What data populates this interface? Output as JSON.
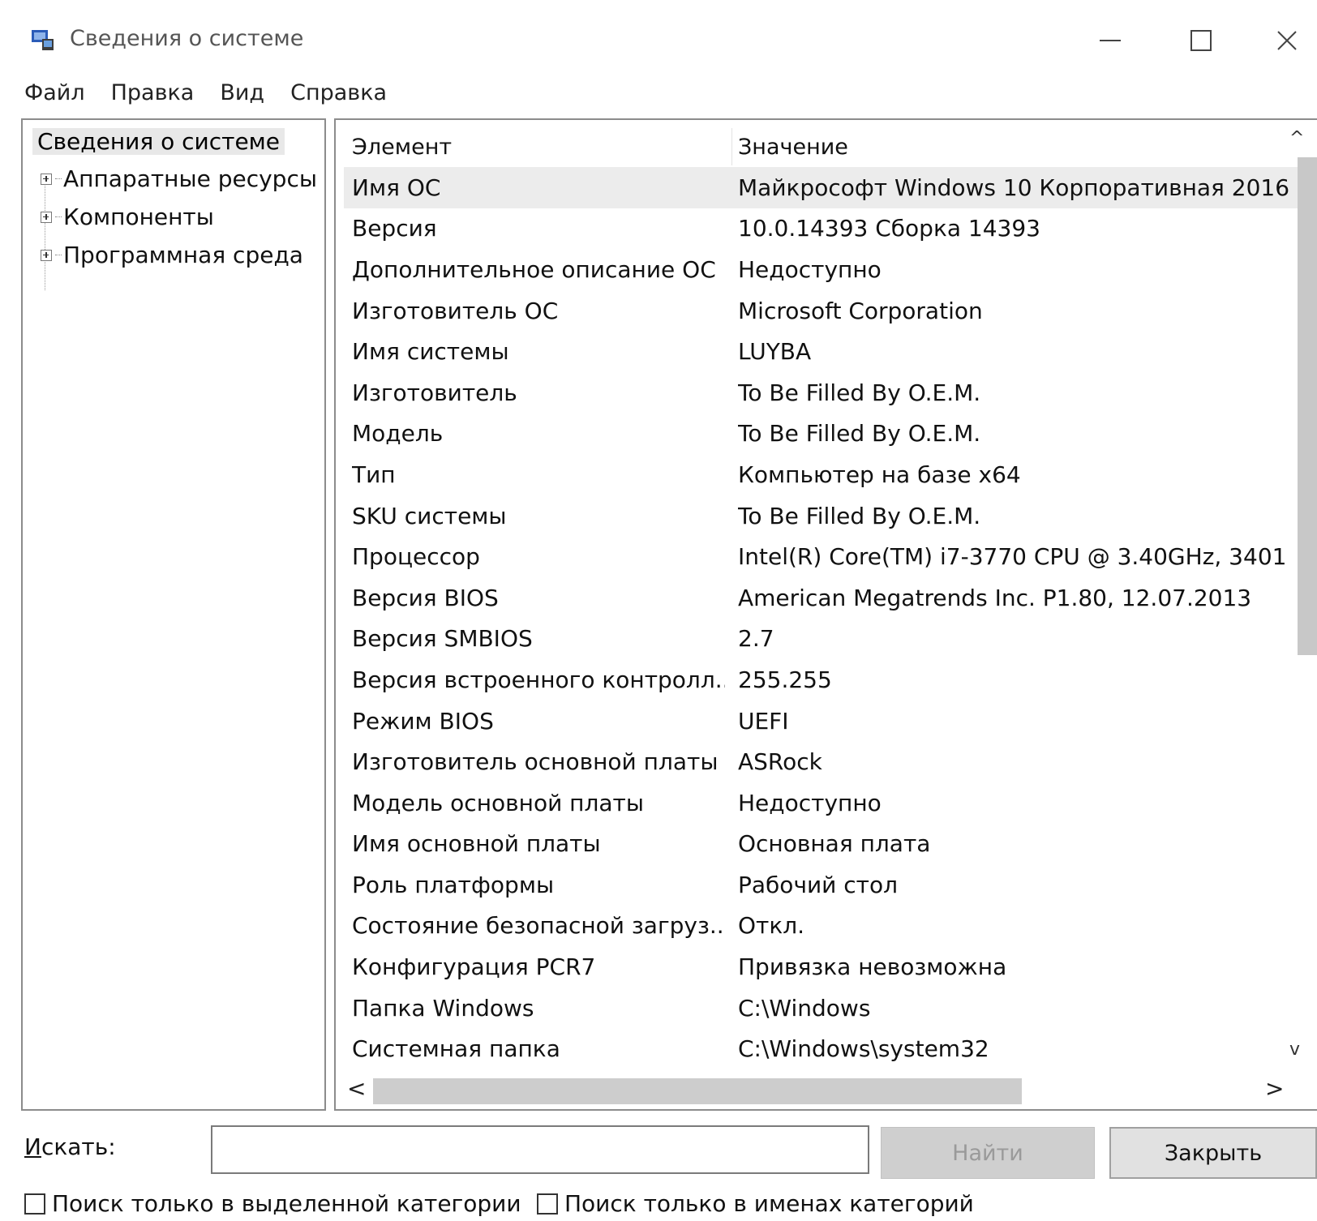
{
  "window": {
    "title": "Сведения о системе",
    "buttons": {
      "minimize": "—",
      "maximize": "☐",
      "close": "✕"
    }
  },
  "menu": [
    "Файл",
    "Правка",
    "Вид",
    "Справка"
  ],
  "tree": {
    "root": "Сведения о системе",
    "nodes": [
      "Аппаратные ресурсы",
      "Компоненты",
      "Программная среда"
    ]
  },
  "list": {
    "headers": {
      "element": "Элемент",
      "value": "Значение"
    },
    "rows": [
      {
        "name": "Имя ОС",
        "value": "Майкрософт Windows 10 Корпоративная 2016"
      },
      {
        "name": "Версия",
        "value": "10.0.14393 Сборка 14393"
      },
      {
        "name": "Дополнительное описание ОС",
        "value": "Недоступно"
      },
      {
        "name": "Изготовитель ОС",
        "value": "Microsoft Corporation"
      },
      {
        "name": "Имя системы",
        "value": "LUYBA"
      },
      {
        "name": "Изготовитель",
        "value": "To Be Filled By O.E.M."
      },
      {
        "name": "Модель",
        "value": "To Be Filled By O.E.M."
      },
      {
        "name": "Тип",
        "value": "Компьютер на базе x64"
      },
      {
        "name": "SKU системы",
        "value": "To Be Filled By O.E.M."
      },
      {
        "name": "Процессор",
        "value": "Intel(R) Core(TM) i7-3770 CPU @ 3.40GHz, 3401"
      },
      {
        "name": "Версия BIOS",
        "value": "American Megatrends Inc. P1.80, 12.07.2013"
      },
      {
        "name": "Версия SMBIOS",
        "value": "2.7"
      },
      {
        "name": "Версия встроенного контролл...",
        "value": "255.255"
      },
      {
        "name": "Режим BIOS",
        "value": "UEFI"
      },
      {
        "name": "Изготовитель основной платы",
        "value": "ASRock"
      },
      {
        "name": "Модель основной платы",
        "value": "Недоступно"
      },
      {
        "name": "Имя основной платы",
        "value": "Основная плата"
      },
      {
        "name": "Роль платформы",
        "value": "Рабочий стол"
      },
      {
        "name": "Состояние безопасной загруз...",
        "value": "Откл."
      },
      {
        "name": "Конфигурация PCR7",
        "value": "Привязка невозможна"
      },
      {
        "name": "Папка Windows",
        "value": "C:\\Windows"
      },
      {
        "name": "Системная папка",
        "value": "C:\\Windows\\system32"
      }
    ]
  },
  "scrollbars": {
    "up": "^",
    "down": "v",
    "left": "<",
    "right": ">"
  },
  "search": {
    "label_accel": "И",
    "label_rest": "скать:",
    "value": "",
    "find_button": "Найти",
    "close_button": "Закрыть",
    "checkbox_selected_category": "Поиск только в выделенной категории",
    "checkbox_category_names": "Поиск только в именах категорий"
  },
  "colors": {
    "selected_row": "#ececec",
    "border": "#8c8c8c",
    "scroll_thumb": "#c8c8c8"
  }
}
